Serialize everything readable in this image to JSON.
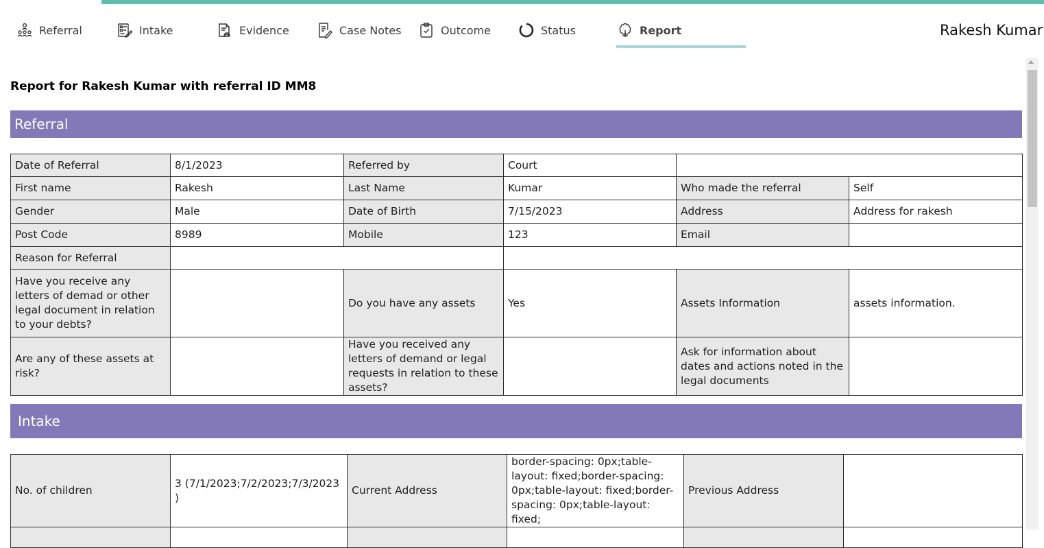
{
  "nav": {
    "tabs": [
      {
        "label": "Referral",
        "icon": "people-network-icon"
      },
      {
        "label": "Intake",
        "icon": "checklist-edit-icon"
      },
      {
        "label": "Evidence",
        "icon": "document-fingerprint-icon"
      },
      {
        "label": "Case Notes",
        "icon": "notes-edit-icon"
      },
      {
        "label": "Outcome",
        "icon": "clipboard-check-icon"
      },
      {
        "label": "Status",
        "icon": "circle-status-icon"
      },
      {
        "label": "Report",
        "icon": "report-hub-icon"
      }
    ],
    "active_tab": "Report",
    "user_name": "Rakesh Kumar"
  },
  "colors": {
    "accent_bar": "#5cbfae",
    "section_header": "#8479b8",
    "label_cell": "#e8e8e8",
    "active_underline": "#a7d6db"
  },
  "report": {
    "title": "Report for Rakesh Kumar with referral ID MM8",
    "referral": {
      "heading": "Referral",
      "rows": {
        "r1": {
          "l1": "Date of Referral",
          "v1": "8/1/2023",
          "l2": "Referred by",
          "v2": "Court"
        },
        "r2": {
          "l1": "First name",
          "v1": "Rakesh",
          "l2": "Last Name",
          "v2": "Kumar",
          "l3": "Who made the referral",
          "v3": "Self"
        },
        "r3": {
          "l1": "Gender",
          "v1": "Male",
          "l2": "Date of Birth",
          "v2": "7/15/2023",
          "l3": "Address",
          "v3": "Address for rakesh"
        },
        "r4": {
          "l1": "Post Code",
          "v1": "8989",
          "l2": "Mobile",
          "v2": "123",
          "l3": "Email",
          "v3": ""
        },
        "r5": {
          "l1": "Reason for Referral",
          "v1": ""
        },
        "r6": {
          "l1": "Have you receive any letters of demad or other legal document in relation to your debts?",
          "v1": "",
          "l2": "Do you have any assets",
          "v2": "Yes",
          "l3": "Assets Information",
          "v3": "assets information."
        },
        "r7": {
          "l1": "Are any of these assets at risk?",
          "v1": "",
          "l2": "Have you received any letters of demand or legal requests in relation to these assets?",
          "v2": "",
          "l3": "Ask for information about dates and actions noted in the legal documents",
          "v3": ""
        }
      }
    },
    "intake": {
      "heading": "Intake",
      "rows": {
        "r1": {
          "l1": "No. of children",
          "v1": "3 (7/1/2023;7/2/2023;7/3/2023 )",
          "l2": "Current Address",
          "v2": "border-spacing: 0px;table-layout: fixed;border-spacing: 0px;table-layout: fixed;border-spacing: 0px;table-layout: fixed;",
          "l3": "Previous Address",
          "v3": ""
        }
      }
    }
  }
}
